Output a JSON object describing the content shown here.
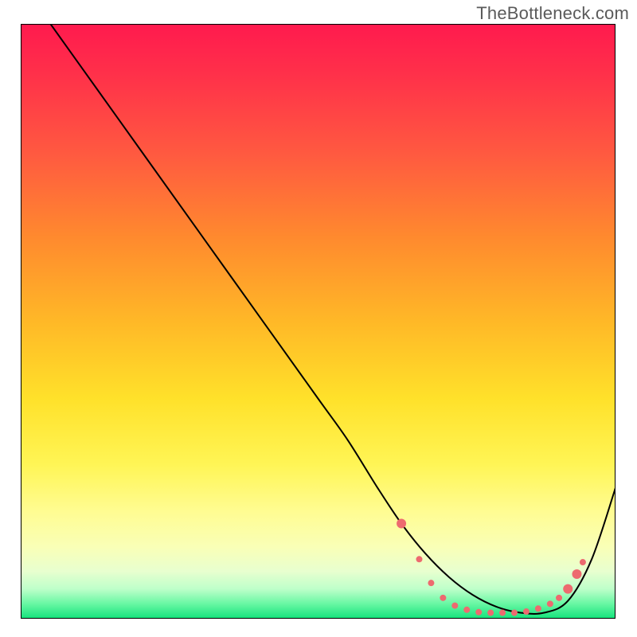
{
  "watermark": "TheBottleneck.com",
  "colors": {
    "curve": "#000000",
    "marker_fill": "#ed6a6f",
    "marker_stroke": "#ed6a6f"
  },
  "chart_data": {
    "type": "line",
    "title": "",
    "xlabel": "",
    "ylabel": "",
    "xlim": [
      0,
      100
    ],
    "ylim": [
      0,
      100
    ],
    "note": "Axis values are relative (0–100) since the source chart has no visible tick labels; y is read top-to-bottom as distance from top edge (0 = top, 100 = bottom).",
    "series": [
      {
        "name": "bottleneck-curve",
        "x": [
          5,
          10,
          20,
          30,
          40,
          50,
          55,
          60,
          64,
          68,
          72,
          76,
          80,
          84,
          88,
          92,
          96,
          100
        ],
        "y": [
          0,
          7,
          21,
          35,
          49,
          63,
          70,
          78,
          84,
          89,
          93,
          96,
          98,
          99,
          99,
          97,
          90,
          78
        ]
      }
    ],
    "markers": {
      "name": "highlight-points",
      "color": "#ed6a6f",
      "radius_small": 4,
      "radius_large": 6,
      "points": [
        {
          "x": 64,
          "y": 84,
          "r": 6
        },
        {
          "x": 67,
          "y": 90,
          "r": 4
        },
        {
          "x": 69,
          "y": 94,
          "r": 4
        },
        {
          "x": 71,
          "y": 96.5,
          "r": 4
        },
        {
          "x": 73,
          "y": 97.8,
          "r": 4
        },
        {
          "x": 75,
          "y": 98.5,
          "r": 4
        },
        {
          "x": 77,
          "y": 98.9,
          "r": 4
        },
        {
          "x": 79,
          "y": 99,
          "r": 4
        },
        {
          "x": 81,
          "y": 99,
          "r": 4
        },
        {
          "x": 83,
          "y": 99,
          "r": 4
        },
        {
          "x": 85,
          "y": 98.8,
          "r": 4
        },
        {
          "x": 87,
          "y": 98.3,
          "r": 4
        },
        {
          "x": 89,
          "y": 97.5,
          "r": 4
        },
        {
          "x": 90.5,
          "y": 96.5,
          "r": 4
        },
        {
          "x": 92,
          "y": 95,
          "r": 6
        },
        {
          "x": 93.5,
          "y": 92.5,
          "r": 6
        },
        {
          "x": 94.5,
          "y": 90.5,
          "r": 4
        }
      ]
    }
  }
}
